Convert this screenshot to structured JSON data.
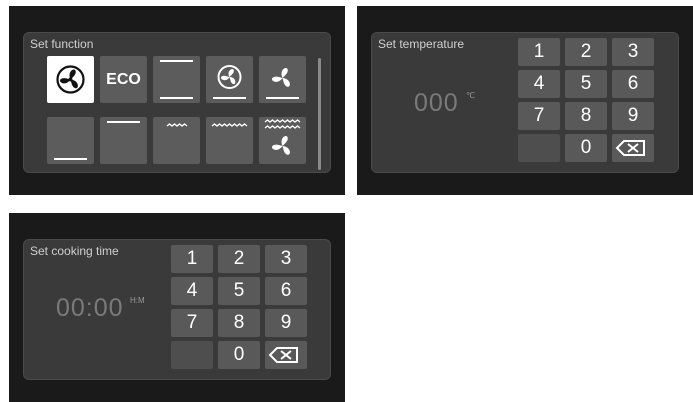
{
  "function_panel": {
    "title": "Set function",
    "buttons": [
      {
        "name": "fan-mode-button",
        "icon": "fan-in-circle-icon",
        "label": "",
        "selected": true
      },
      {
        "name": "eco-mode-button",
        "icon": "",
        "label": "ECO",
        "selected": false
      },
      {
        "name": "top-bottom-heat-button",
        "icon": "top-bottom-heat-icon",
        "label": "",
        "selected": false
      },
      {
        "name": "fan-circular-heat-button",
        "icon": "fan-circular-heat-icon",
        "label": "",
        "selected": false
      },
      {
        "name": "fan-bottom-heat-button",
        "icon": "fan-bottom-heat-icon",
        "label": "",
        "selected": false
      },
      {
        "name": "bottom-heat-button",
        "icon": "bottom-heat-icon",
        "label": "",
        "selected": false
      },
      {
        "name": "top-heat-button",
        "icon": "top-heat-icon",
        "label": "",
        "selected": false
      },
      {
        "name": "grill-button",
        "icon": "grill-icon",
        "label": "",
        "selected": false
      },
      {
        "name": "double-grill-button",
        "icon": "double-grill-icon",
        "label": "",
        "selected": false
      },
      {
        "name": "fan-grill-button",
        "icon": "fan-grill-icon",
        "label": "",
        "selected": false
      }
    ]
  },
  "temperature_panel": {
    "title": "Set temperature",
    "value": "000",
    "unit": "℃",
    "keys": [
      "1",
      "2",
      "3",
      "4",
      "5",
      "6",
      "7",
      "8",
      "9",
      "",
      "0",
      "backspace-icon"
    ]
  },
  "time_panel": {
    "title": "Set cooking time",
    "value": "00:00",
    "unit": "H:M",
    "keys": [
      "1",
      "2",
      "3",
      "4",
      "5",
      "6",
      "7",
      "8",
      "9",
      "",
      "0",
      "backspace-icon"
    ]
  },
  "colors": {
    "screen_bg": "#1a1a1a",
    "panel_bg": "#3a3a3a",
    "button_bg": "#5c5c5c",
    "selected_button_bg": "#ffffff",
    "readout_text": "#7a7a7a"
  }
}
